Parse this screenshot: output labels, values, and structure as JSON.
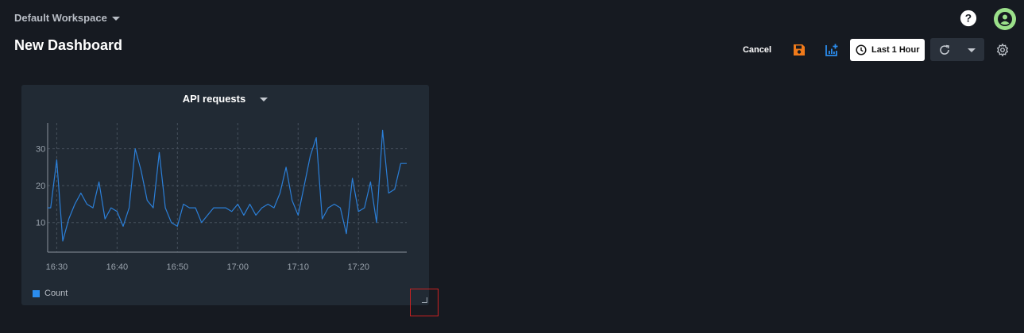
{
  "header": {
    "workspace": "Default Workspace",
    "title": "New Dashboard",
    "help_icon": "help-circle-icon",
    "avatar_icon": "account-circle-icon"
  },
  "toolbar": {
    "cancel_label": "Cancel",
    "save_icon": "floppy-disk-icon",
    "add_chart_icon": "add-chart-icon",
    "time_range_label": "Last 1 Hour",
    "time_icon": "clock-icon",
    "refresh_icon": "refresh-icon",
    "settings_icon": "gear-icon"
  },
  "colors": {
    "background": "#161a21",
    "panel": "#212a34",
    "accent_orange": "#f07a1a",
    "accent_blue": "#2b8ced",
    "series_line": "#2b7fd8"
  },
  "panel": {
    "title": "API requests",
    "legend_label": "Count"
  },
  "chart_data": {
    "type": "line",
    "title": "API requests",
    "xlabel": "",
    "ylabel": "",
    "x_ticks": [
      "16:30",
      "16:40",
      "16:50",
      "17:00",
      "17:10",
      "17:20"
    ],
    "y_ticks": [
      10,
      20,
      30
    ],
    "ylim": [
      2,
      37
    ],
    "xlim_minutes": [
      -1.5,
      58
    ],
    "grid": true,
    "legend": "bottom-left",
    "series": [
      {
        "name": "Count",
        "x_minutes": [
          -1.5,
          -1,
          0,
          1,
          2,
          3,
          4,
          5,
          6,
          7,
          8,
          9,
          10,
          11,
          12,
          13,
          14,
          15,
          16,
          17,
          18,
          19,
          20,
          21,
          22,
          23,
          24,
          25,
          26,
          27,
          28,
          29,
          30,
          31,
          32,
          33,
          34,
          35,
          36,
          37,
          38,
          39,
          40,
          41,
          42,
          43,
          44,
          45,
          46,
          47,
          48,
          49,
          50,
          51,
          52,
          53,
          54,
          55,
          56,
          57,
          58
        ],
        "values": [
          14,
          14,
          27,
          5,
          11,
          15,
          18,
          15,
          14,
          21,
          11,
          14,
          13,
          9,
          14,
          30,
          24,
          16,
          14,
          29,
          14,
          10,
          9,
          15,
          14,
          14,
          10,
          12,
          14,
          14,
          14,
          13,
          15,
          12,
          15,
          12,
          14,
          15,
          14,
          18,
          25,
          16,
          12,
          20,
          28,
          33,
          11,
          14,
          15,
          14,
          7,
          22,
          13,
          14,
          21,
          10,
          35,
          18,
          19,
          26,
          26
        ]
      }
    ]
  }
}
